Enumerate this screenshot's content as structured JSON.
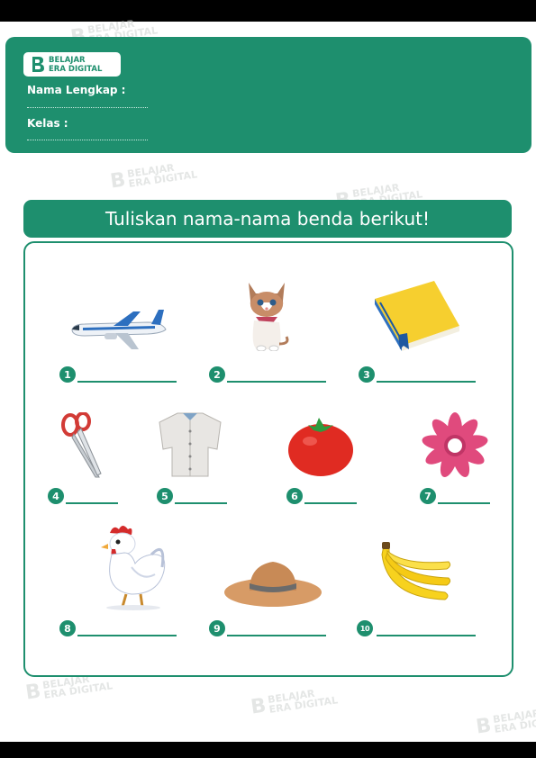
{
  "logo": {
    "line1": "BELAJAR",
    "line2": "ERA DIGITAL"
  },
  "header": {
    "name_label": "Nama Lengkap :",
    "class_label": "Kelas :"
  },
  "title": "Tuliskan nama-nama benda berikut!",
  "watermark": {
    "line1": "BELAJAR",
    "line2": "ERA DIGITAL"
  },
  "items": [
    {
      "number": "1",
      "icon": "airplane-icon"
    },
    {
      "number": "2",
      "icon": "cat-icon"
    },
    {
      "number": "3",
      "icon": "book-icon"
    },
    {
      "number": "4",
      "icon": "scissors-icon"
    },
    {
      "number": "5",
      "icon": "shirt-icon"
    },
    {
      "number": "6",
      "icon": "tomato-icon"
    },
    {
      "number": "7",
      "icon": "flower-icon"
    },
    {
      "number": "8",
      "icon": "rooster-icon"
    },
    {
      "number": "9",
      "icon": "hat-icon"
    },
    {
      "number": "10",
      "icon": "banana-icon"
    }
  ],
  "colors": {
    "primary": "#1e8f6e",
    "background": "#ffffff"
  }
}
